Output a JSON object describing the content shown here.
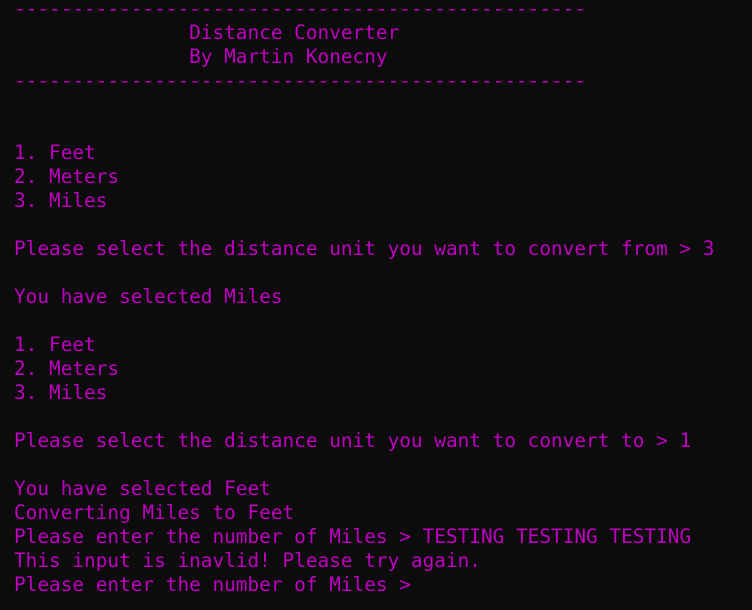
{
  "colors": {
    "background": "#0c0c0c",
    "text": "#c000c0"
  },
  "banner": {
    "divider_top": "-------------------------------------------------",
    "title": "               Distance Converter",
    "author": "               By Martin Konecny",
    "divider_bottom": "-------------------------------------------------"
  },
  "menu_from": {
    "item_1": "1. Feet",
    "item_2": "2. Meters",
    "item_3": "3. Miles"
  },
  "prompt_from": {
    "text": "Please select the distance unit you want to convert from > ",
    "input": "3"
  },
  "selected_from": "You have selected Miles",
  "menu_to": {
    "item_1": "1. Feet",
    "item_2": "2. Meters",
    "item_3": "3. Miles"
  },
  "prompt_to": {
    "text": "Please select the distance unit you want to convert to > ",
    "input": "1"
  },
  "selected_to": "You have selected Feet",
  "converting": "Converting Miles to Feet",
  "prompt_number_1": {
    "text": "Please enter the number of Miles > ",
    "input": "TESTING TESTING TESTING"
  },
  "error": "This input is inavlid! Please try again.",
  "prompt_number_2": {
    "text": "Please enter the number of Miles > ",
    "input": ""
  }
}
